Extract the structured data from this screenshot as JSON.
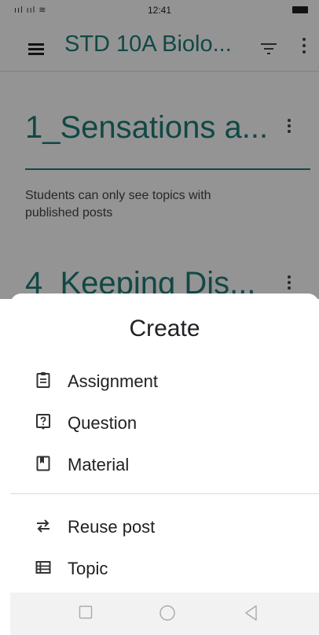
{
  "status_bar": {
    "signal_text": "ııl ııl ≋",
    "time": "12:41"
  },
  "app_bar": {
    "title": "STD 10A Biolo..."
  },
  "topics": [
    {
      "title": "1_Sensations a..."
    },
    {
      "title": "4_Keeping Dis..."
    }
  ],
  "info_text": "Students can only see topics with published posts",
  "sheet": {
    "title": "Create",
    "items": [
      {
        "label": "Assignment",
        "icon": "assignment-icon"
      },
      {
        "label": "Question",
        "icon": "question-icon"
      },
      {
        "label": "Material",
        "icon": "material-icon"
      },
      {
        "label": "Reuse post",
        "icon": "reuse-icon"
      },
      {
        "label": "Topic",
        "icon": "topic-icon"
      }
    ]
  },
  "nav_bar": {
    "icons": [
      "recents-icon",
      "home-icon",
      "back-icon"
    ]
  },
  "colors": {
    "accent": "#1e7c78",
    "text": "#202124"
  }
}
